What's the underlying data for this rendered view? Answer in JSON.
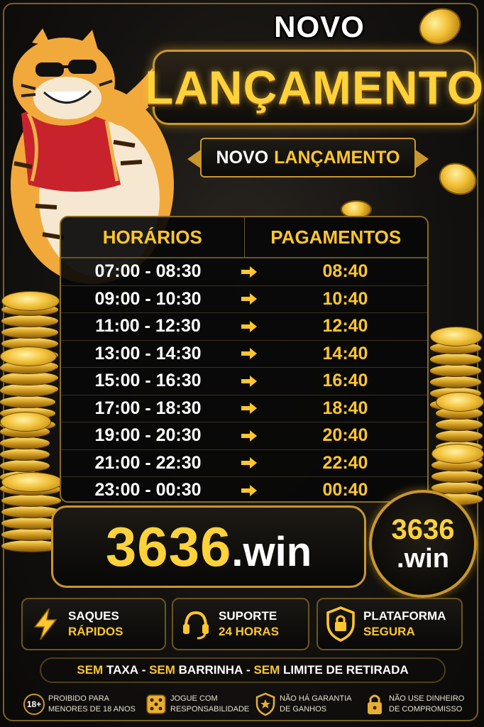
{
  "header": {
    "title_top": "NOVO",
    "title_main": "LANÇAMENTO",
    "ribbon_white": "NOVO",
    "ribbon_gold": "LANÇAMENTO"
  },
  "schedule": {
    "col_times": "HORÁRIOS",
    "col_payments": "PAGAMENTOS",
    "rows": [
      {
        "time": "07:00 - 08:30",
        "pay": "08:40"
      },
      {
        "time": "09:00 - 10:30",
        "pay": "10:40"
      },
      {
        "time": "11:00 - 12:30",
        "pay": "12:40"
      },
      {
        "time": "13:00 - 14:30",
        "pay": "14:40"
      },
      {
        "time": "15:00 - 16:30",
        "pay": "16:40"
      },
      {
        "time": "17:00 - 18:30",
        "pay": "18:40"
      },
      {
        "time": "19:00 - 20:30",
        "pay": "20:40"
      },
      {
        "time": "21:00 - 22:30",
        "pay": "22:40"
      },
      {
        "time": "23:00 - 00:30",
        "pay": "00:40"
      }
    ]
  },
  "brand": {
    "number": "3636",
    "domain": ".win",
    "badge_number": "3636",
    "badge_domain": ".win"
  },
  "features": [
    {
      "line1": "SAQUES",
      "line2": "RÁPIDOS",
      "icon": "lightning-icon"
    },
    {
      "line1": "SUPORTE",
      "line2": "24 HORAS",
      "icon": "headset-icon"
    },
    {
      "line1": "PLATAFORMA",
      "line2": "SEGURA",
      "icon": "shield-lock-icon"
    }
  ],
  "banner": {
    "p1": "SEM",
    "p2": "TAXA",
    "sep1": " - ",
    "p3": "SEM",
    "p4": "BARRINHA",
    "sep2": " - ",
    "p5": "SEM",
    "p6": "LIMITE DE RETIRADA"
  },
  "footer": [
    {
      "badge": "18+",
      "line1": "PROIBIDO PARA",
      "line2": "MENORES DE 18 ANOS",
      "icon": "age-18-icon"
    },
    {
      "line1": "JOGUE COM",
      "line2": "RESPONSABILIDADE",
      "icon": "dice-icon"
    },
    {
      "line1": "NÃO HÁ GARANTIA",
      "line2": "DE GANHOS",
      "icon": "shield-star-icon"
    },
    {
      "line1": "NÃO USE DINHEIRO",
      "line2": "DE COMPROMISSO",
      "icon": "padlock-icon"
    }
  ],
  "colors": {
    "gold": "#ffc62e",
    "accent": "#ffd23a",
    "border": "#c9972c",
    "background": "#141210"
  }
}
